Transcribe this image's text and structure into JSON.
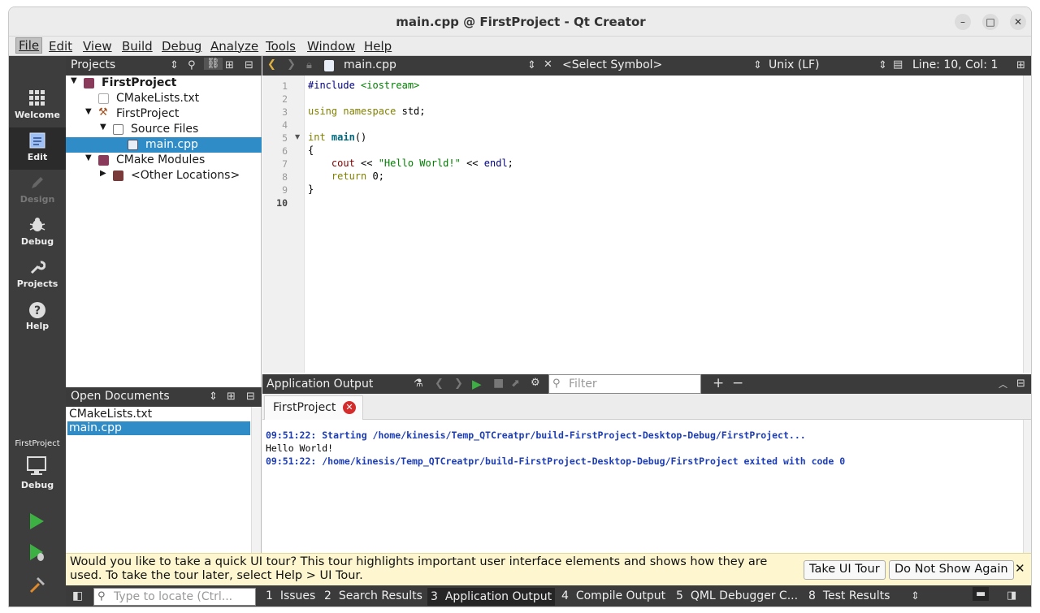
{
  "window": {
    "title": "main.cpp @ FirstProject - Qt Creator"
  },
  "menu": [
    "File",
    "Edit",
    "View",
    "Build",
    "Debug",
    "Analyze",
    "Tools",
    "Window",
    "Help"
  ],
  "modes": [
    {
      "label": "Welcome",
      "icon": "grid-icon"
    },
    {
      "label": "Edit",
      "icon": "edit-document-icon"
    },
    {
      "label": "Design",
      "icon": "pen-icon"
    },
    {
      "label": "Debug",
      "icon": "bug-icon"
    },
    {
      "label": "Projects",
      "icon": "wrench-icon"
    },
    {
      "label": "Help",
      "icon": "help-icon"
    }
  ],
  "kit": {
    "project": "FirstProject",
    "config": "Debug"
  },
  "projects": {
    "header": "Projects",
    "tree": [
      {
        "label": "FirstProject",
        "depth": 0,
        "bold": true
      },
      {
        "label": "CMakeLists.txt",
        "depth": 1
      },
      {
        "label": "FirstProject",
        "depth": 1
      },
      {
        "label": "Source Files",
        "depth": 2
      },
      {
        "label": "main.cpp",
        "depth": 3,
        "selected": true
      },
      {
        "label": "CMake Modules",
        "depth": 1
      },
      {
        "label": "<Other Locations>",
        "depth": 2
      }
    ]
  },
  "open_documents": {
    "header": "Open Documents",
    "items": [
      "CMakeLists.txt",
      "main.cpp"
    ],
    "selected": 1
  },
  "editor": {
    "file": "main.cpp",
    "symbol": "<Select Symbol>",
    "line_ending": "Unix (LF)",
    "position": "Line: 10, Col: 1",
    "line_numbers": [
      "1",
      "2",
      "3",
      "4",
      "5",
      "6",
      "7",
      "8",
      "9",
      "10"
    ],
    "lines": {
      "l1_kw": "#include",
      "l1_rest": " <iostream>",
      "l3_kw": "using namespace",
      "l3_rest": " std;",
      "l5_kw": "int",
      "l5_fn": " main",
      "l5_rest": "()",
      "l6": "{",
      "l7_a": "    cout",
      "l7_b": " << ",
      "l7_c": "\"Hello World!\"",
      "l7_d": " << ",
      "l7_e": "endl",
      ";": ";",
      "l8_kw": "    return",
      "l8_rest": " 0;",
      "l9": "}"
    }
  },
  "output": {
    "header": "Application Output",
    "filter_placeholder": "Filter",
    "tab": "FirstProject",
    "lines": [
      "09:51:22: Starting /home/kinesis/Temp_QTCreatpr/build-FirstProject-Desktop-Debug/FirstProject...",
      "Hello World!",
      "09:51:22: /home/kinesis/Temp_QTCreatpr/build-FirstProject-Desktop-Debug/FirstProject exited with code 0"
    ]
  },
  "infobar": {
    "message": "Would you like to take a quick UI tour? This tour highlights important user interface elements and shows how they are used. To take the tour later, select Help > UI Tour.",
    "tour_button": "Take UI Tour",
    "dismiss_button": "Do Not Show Again"
  },
  "statusbar": {
    "locator_placeholder": "Type to locate (Ctrl...",
    "panes": [
      {
        "num": "1",
        "label": "Issues"
      },
      {
        "num": "2",
        "label": "Search Results"
      },
      {
        "num": "3",
        "label": "Application Output",
        "active": true
      },
      {
        "num": "4",
        "label": "Compile Output"
      },
      {
        "num": "5",
        "label": "QML Debugger C..."
      },
      {
        "num": "8",
        "label": "Test Results"
      }
    ]
  },
  "colors": {
    "accent": "#308cc6",
    "keyword": "#808000",
    "string": "#008000",
    "type": "#000080",
    "output_blue": "#1d3db5"
  }
}
